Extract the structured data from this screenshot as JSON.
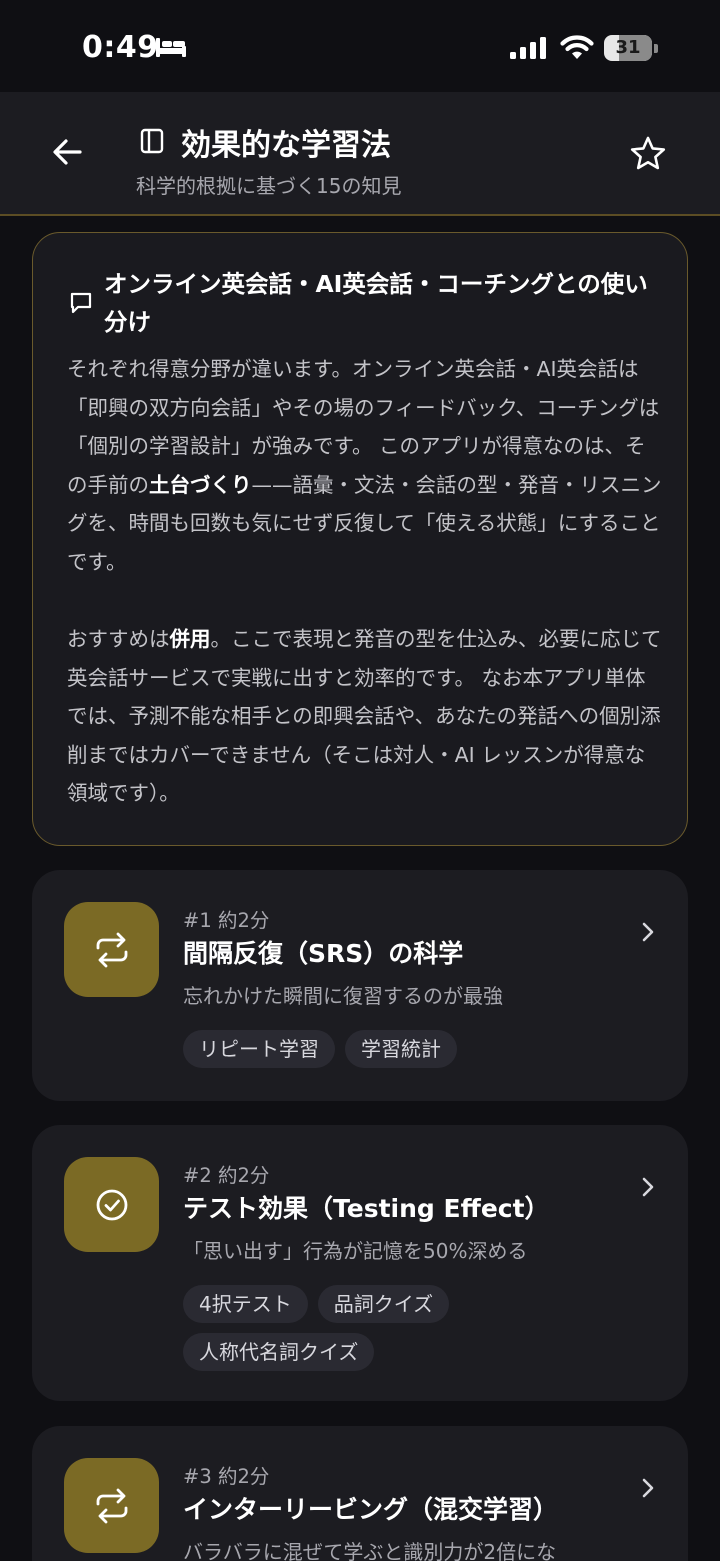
{
  "status_bar": {
    "time": "0:49",
    "battery": "31",
    "battery_level_percent": 31
  },
  "header": {
    "title": "効果的な学習法",
    "subtitle": "科学的根拠に基づく15の知見",
    "back_icon": "arrow-left-icon",
    "book_icon": "book-icon",
    "star_icon": "star-icon"
  },
  "info_card": {
    "heading": "オンライン英会話・AI英会話・コーチングとの使い分け",
    "p1_a": "それぞれ得意分野が違います。オンライン英会話・AI英会話は「即興の双方向会話」やその場のフィードバック、コーチングは「個別の学習設計」が強みです。 このアプリが得意なのは、その手前の",
    "p1_b": "土台づくり",
    "p1_c": "——語彙・文法・会話の型・発音・リスニングを、時間も回数も気にせず反復して「使える状態」にすることです。",
    "p2_a": "おすすめは",
    "p2_b": "併用",
    "p2_c": "。ここで表現と発音の型を仕込み、必要に応じて英会話サービスで実戦に出すと効率的です。 なお本アプリ単体では、予測不能な相手との即興会話や、あなたの発話への個別添削まではカバーできません（そこは対人・AI レッスンが得意な領域です）。"
  },
  "lessons": [
    {
      "meta": "#1  約2分",
      "title": "間隔反復（SRS）の科学",
      "desc": "忘れかけた瞬間に復習するのが最強",
      "icon": "repeat-icon",
      "tags": [
        "リピート学習",
        "学習統計"
      ]
    },
    {
      "meta": "#2  約2分",
      "title": "テスト効果（Testing Effect）",
      "desc": "「思い出す」行為が記憶を50%深める",
      "icon": "check-circle-icon",
      "tags": [
        "4択テスト",
        "品詞クイズ",
        "人称代名詞クイズ"
      ]
    },
    {
      "meta": "#3  約2分",
      "title": "インターリービング（混交学習）",
      "desc": "バラバラに混ぜて学ぶと識別力が2倍にな",
      "icon": "repeat-icon",
      "tags": []
    }
  ]
}
